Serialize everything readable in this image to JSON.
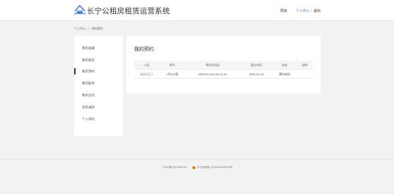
{
  "header": {
    "site_title": "长宁公租房租赁运营系统",
    "nav_home": "项目",
    "nav_center": "个人中心",
    "nav_separator": "|",
    "nav_logout": "退出"
  },
  "breadcrumb": {
    "parent": "个人中心",
    "arrow": ">",
    "current": "我的预约"
  },
  "sidebar": {
    "items": [
      {
        "label": "我的收藏"
      },
      {
        "label": "我的报名"
      },
      {
        "label": "我的预约"
      },
      {
        "label": "我的账单"
      },
      {
        "label": "我的合同"
      },
      {
        "label": "消息通知"
      },
      {
        "label": "个人资料"
      }
    ],
    "active_index": 2
  },
  "main": {
    "title": "我的预约",
    "table": {
      "headers": [
        "小区",
        "房号",
        "预约时间段",
        "提交时间",
        "状态",
        "操作"
      ],
      "rows": [
        {
          "community": "油田社区二",
          "room": "1号245室",
          "slot": "2025-01-16 8:00-11:00",
          "submitted": "2025-01-15",
          "status": "预约成功",
          "action": ""
        }
      ]
    }
  },
  "footer": {
    "icp": "沪ICP备11014887号-1",
    "police": "沪公网安备 31010502005033号"
  },
  "colors": {
    "accent": "#3a7bd5",
    "background": "#f2f2f2",
    "panel": "#ffffff"
  }
}
